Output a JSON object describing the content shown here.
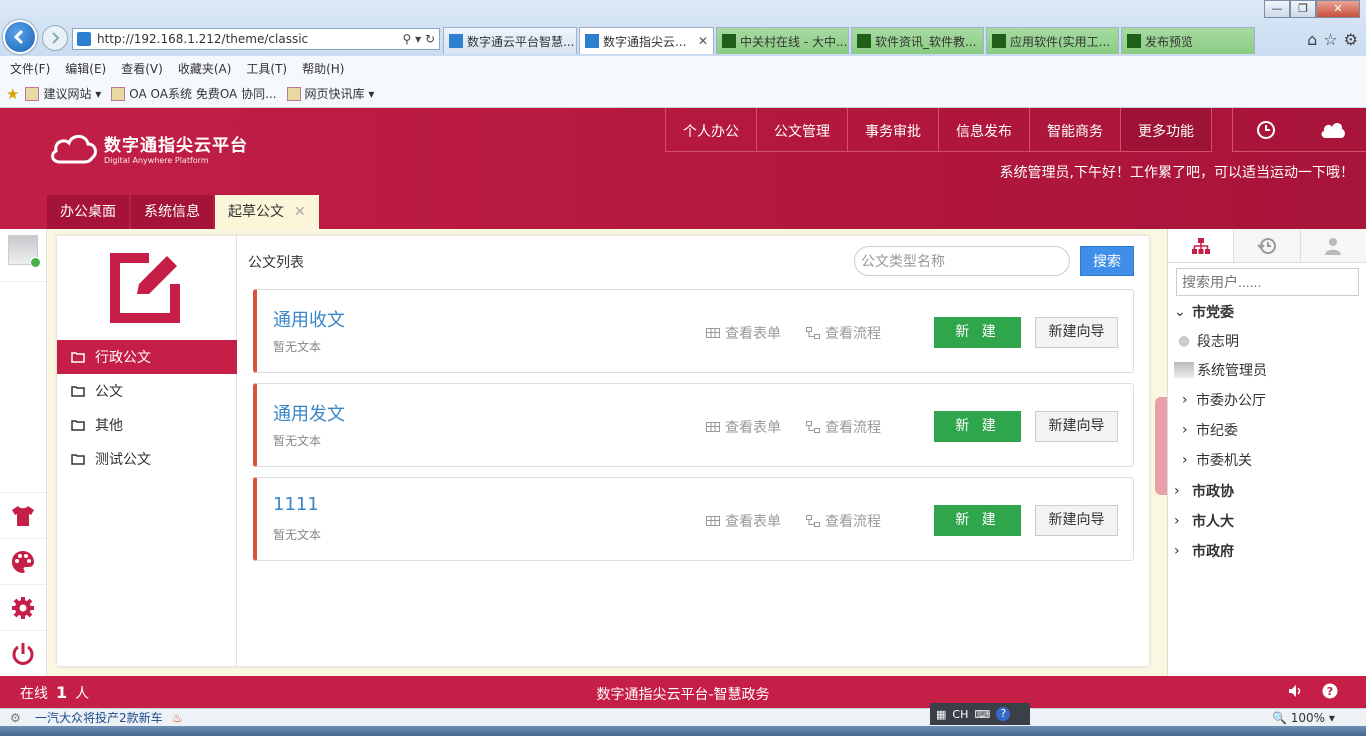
{
  "browser": {
    "address": "http://192.168.1.212/theme/classic",
    "tabs": [
      {
        "label": "数字通云平台智慧...",
        "active": false,
        "color": "blue"
      },
      {
        "label": "数字通指尖云...",
        "active": true,
        "color": "blue"
      },
      {
        "label": "中关村在线 - 大中...",
        "active": false,
        "color": "green"
      },
      {
        "label": "软件资讯_软件教...",
        "active": false,
        "color": "green"
      },
      {
        "label": "应用软件(实用工...",
        "active": false,
        "color": "green"
      },
      {
        "label": "发布预览",
        "active": false,
        "color": "green"
      }
    ],
    "menu": [
      "文件(F)",
      "编辑(E)",
      "查看(V)",
      "收藏夹(A)",
      "工具(T)",
      "帮助(H)"
    ],
    "favorites": [
      "建议网站 ▾",
      "OA OA系统 免费OA 协同...",
      "网页快讯库 ▾"
    ]
  },
  "app": {
    "logo_title": "数字通指尖云平台",
    "logo_subtitle": "Digital Anywhere Platform",
    "topnav": [
      "个人办公",
      "公文管理",
      "事务审批",
      "信息发布",
      "智能商务",
      "更多功能"
    ],
    "greeting": "系统管理员,下午好！工作累了吧，可以适当运动一下哦！",
    "tabs": [
      "办公桌面",
      "系统信息",
      "起草公文"
    ],
    "brand_color": "#c51f47"
  },
  "categories": [
    "行政公文",
    "公文",
    "其他",
    "测试公文"
  ],
  "list": {
    "title": "公文列表",
    "search_placeholder": "公文类型名称",
    "search_button": "搜索",
    "view_form": "查看表单",
    "view_flow": "查看流程",
    "new_label": "新 建",
    "guide_label": "新建向导",
    "items": [
      {
        "name": "通用收文",
        "desc": "暂无文本"
      },
      {
        "name": "通用发文",
        "desc": "暂无文本"
      },
      {
        "name": "1111",
        "desc": "暂无文本"
      }
    ]
  },
  "right_panel": {
    "search_placeholder": "搜索用户......",
    "tree": [
      {
        "label": "市党委",
        "level": 0,
        "expanded": true
      },
      {
        "label": "段志明",
        "level": 1,
        "type": "user"
      },
      {
        "label": "系统管理员",
        "level": 1,
        "type": "user"
      },
      {
        "label": "市委办公厅",
        "level": 1,
        "type": "group"
      },
      {
        "label": "市纪委",
        "level": 1,
        "type": "group"
      },
      {
        "label": "市委机关",
        "level": 1,
        "type": "group"
      },
      {
        "label": "市政协",
        "level": 0,
        "expanded": false
      },
      {
        "label": "市人大",
        "level": 0,
        "expanded": false
      },
      {
        "label": "市政府",
        "level": 0,
        "expanded": false
      }
    ]
  },
  "footer": {
    "online_label": "在线",
    "online_count": "1",
    "online_unit": "人",
    "center": "数字通指尖云平台-智慧政务"
  },
  "statusbar": {
    "news": "一汽大众将投产2款新车",
    "ime": "CH",
    "zoom": "100%"
  }
}
